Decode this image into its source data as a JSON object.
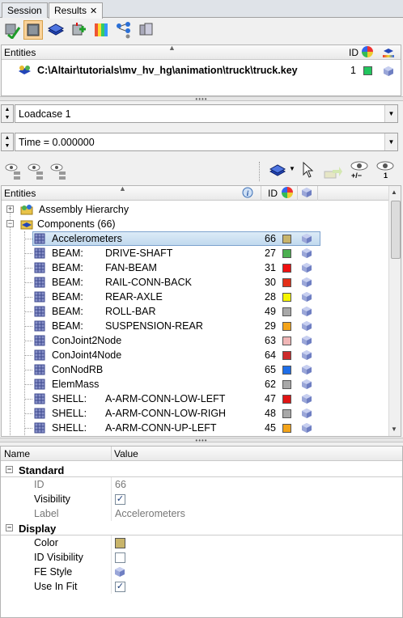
{
  "tabs": [
    {
      "label": "Session",
      "active": false
    },
    {
      "label": "Results",
      "active": true,
      "close": "✕"
    }
  ],
  "toolbar1": {
    "icons": [
      "apply-results-icon",
      "open-model-icon",
      "layers-icon",
      "add-result-icon",
      "contour-legend-icon",
      "tree-hierarchy-icon",
      "components-stack-icon"
    ]
  },
  "entities_top": {
    "header": {
      "title": "Entities",
      "id": "ID"
    },
    "row": {
      "path": "C:\\Altair\\tutorials\\mv_hv_hg\\animation\\truck\\truck.key",
      "id": "1",
      "color": "#22c55e"
    }
  },
  "loadcase": {
    "value": "Loadcase 1"
  },
  "time": {
    "value": "Time = 0.000000"
  },
  "toolbar2": {
    "eye_plusminus": "+/−",
    "eye_one": "1"
  },
  "entities": {
    "header": {
      "title": "Entities",
      "id": "ID"
    },
    "assembly": "Assembly Hierarchy",
    "components": "Components (66)",
    "rows": [
      {
        "label": "Accelerometers",
        "sub": "",
        "id": "66",
        "color": "#c8b46a",
        "selected": true
      },
      {
        "label": "BEAM:",
        "sub": "DRIVE-SHAFT",
        "id": "27",
        "color": "#4caf50"
      },
      {
        "label": "BEAM:",
        "sub": "FAN-BEAM",
        "id": "31",
        "color": "#ef1010"
      },
      {
        "label": "BEAM:",
        "sub": "RAIL-CONN-BACK",
        "id": "30",
        "color": "#e33018"
      },
      {
        "label": "BEAM:",
        "sub": "REAR-AXLE",
        "id": "28",
        "color": "#f5f500"
      },
      {
        "label": "BEAM:",
        "sub": "ROLL-BAR",
        "id": "49",
        "color": "#a8a8a8"
      },
      {
        "label": "BEAM:",
        "sub": "SUSPENSION-REAR",
        "id": "29",
        "color": "#f3a41a"
      },
      {
        "label": "ConJoint2Node",
        "sub": "",
        "id": "63",
        "color": "#f0b6b6"
      },
      {
        "label": "ConJoint4Node",
        "sub": "",
        "id": "64",
        "color": "#cc2a2a"
      },
      {
        "label": "ConNodRB",
        "sub": "",
        "id": "65",
        "color": "#1e6ee8"
      },
      {
        "label": "ElemMass",
        "sub": "",
        "id": "62",
        "color": "#a8a8a8"
      },
      {
        "label": "SHELL:",
        "sub": "A-ARM-CONN-LOW-LEFT",
        "id": "47",
        "color": "#e01414"
      },
      {
        "label": "SHELL:",
        "sub": "A-ARM-CONN-LOW-RIGH",
        "id": "48",
        "color": "#a8a8a8"
      },
      {
        "label": "SHELL:",
        "sub": "A-ARM-CONN-UP-LEFT",
        "id": "45",
        "color": "#f3a41a"
      }
    ]
  },
  "props": {
    "header": {
      "name": "Name",
      "value": "Value"
    },
    "sections": [
      {
        "title": "Standard",
        "items": [
          {
            "name": "ID",
            "value": "66",
            "kind": "text",
            "dim": true
          },
          {
            "name": "Visibility",
            "value": "",
            "kind": "check",
            "checked": true
          },
          {
            "name": "Label",
            "value": "Accelerometers",
            "kind": "text",
            "dim": true
          }
        ]
      },
      {
        "title": "Display",
        "items": [
          {
            "name": "Color",
            "value": "",
            "kind": "swatch",
            "color": "#c8b46a"
          },
          {
            "name": "ID Visibility",
            "value": "",
            "kind": "check",
            "checked": false
          },
          {
            "name": "FE Style",
            "value": "",
            "kind": "cube"
          },
          {
            "name": "Use In Fit",
            "value": "",
            "kind": "check",
            "checked": true
          }
        ]
      }
    ]
  }
}
